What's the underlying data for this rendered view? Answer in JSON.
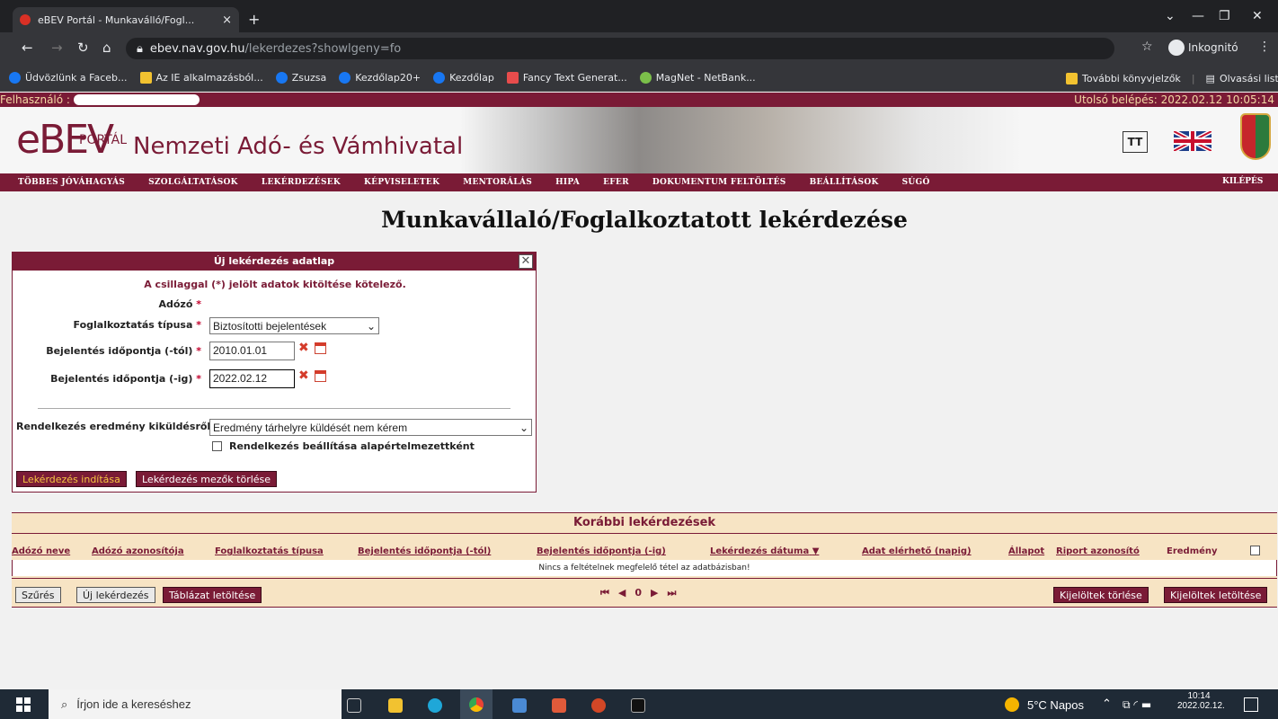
{
  "browser": {
    "tab_title": "eBEV Portál - Munkaválló/Fogl...",
    "new_tab": "+",
    "url_host": "ebev.nav.gov.hu",
    "url_path": "/lekerdezes?showlgeny=fo",
    "incognito_label": "Inkognitó",
    "bookmarks": [
      {
        "label": "Üdvözlünk a Faceb...",
        "color": "#1877f2"
      },
      {
        "label": "Az IE alkalmazásból...",
        "color": "#f2c230"
      },
      {
        "label": "Zsuzsa",
        "color": "#1877f2"
      },
      {
        "label": "Kezdőlap20+",
        "color": "#1877f2"
      },
      {
        "label": "Kezdőlap",
        "color": "#1877f2"
      },
      {
        "label": "Fancy Text Generat...",
        "color": "#e84c4c"
      },
      {
        "label": "MagNet - NetBank...",
        "color": "#7bbf4a"
      }
    ],
    "bookmarks_right": [
      "További könyvjelzők",
      "Olvasási lista"
    ]
  },
  "site": {
    "user_label": "Felhasználó :",
    "last_login": "Utolsó belépés: 2022.02.12 10:05:14",
    "logo_big": "eBEV",
    "logo_small": "PORTÁL",
    "agency": "Nemzeti Adó- és Vámhivatal",
    "text_size_btn": "TT",
    "menu": [
      "TÖBBES JÓVÁHAGYÁS",
      "SZOLGÁLTATÁSOK",
      "LEKÉRDEZÉSEK",
      "KÉPVISELETEK",
      "MENTORÁLÁS",
      "HIPA",
      "EFER",
      "DOKUMENTUM FELTÖLTÉS",
      "BEÁLLÍTÁSOK",
      "SÚGÓ"
    ],
    "logout": "KILÉPÉS"
  },
  "page_title": "Munkavállaló/Foglalkoztatott lekérdezése",
  "form": {
    "header": "Új lekérdezés adatlap",
    "close": "✕",
    "note": "A csillaggal (*) jelölt adatok kitöltése kötelező.",
    "adozo_label": "Adózó",
    "tipus_label": "Foglalkoztatás típusa",
    "tipus_value": "Biztosítotti bejelentések",
    "tol_label": "Bejelentés időpontja (-tól)",
    "tol_value": "2010.01.01",
    "ig_label": "Bejelentés időpontja (-ig)",
    "ig_value": "2022.02.12",
    "rendelkezes_label": "Rendelkezés eredmény kiküldésről",
    "rendelkezes_value": "Eredmény tárhelyre küldését nem kérem",
    "checkbox_label": "Rendelkezés beállítása alapértelmezettként",
    "star": "*",
    "btn_start": "Lekérdezés indítása",
    "btn_clear": "Lekérdezés mezők törlése"
  },
  "results": {
    "title": "Korábbi lekérdezések",
    "columns": [
      "Adózó neve",
      "Adózó azonosítója",
      "Foglalkoztatás típusa",
      "Bejelentés időpontja (-tól)",
      "Bejelentés időpontja (-ig)",
      "Lekérdezés dátuma",
      "Adat elérhető (napig)",
      "Állapot",
      "Riport azonosító",
      "Eredmény"
    ],
    "empty": "Nincs a feltételnek megfelelő tétel az adatbázisban!",
    "page": "0",
    "btn_filter": "Szűrés",
    "btn_new": "Új lekérdezés",
    "btn_download_table": "Táblázat letöltése",
    "btn_delete_selected": "Kijelöltek törlése",
    "btn_download_selected": "Kijelöltek letöltése"
  },
  "taskbar": {
    "search_placeholder": "Írjon ide a kereséshez",
    "weather": "5°C Napos",
    "time": "10:14",
    "date": "2022.02.12."
  }
}
